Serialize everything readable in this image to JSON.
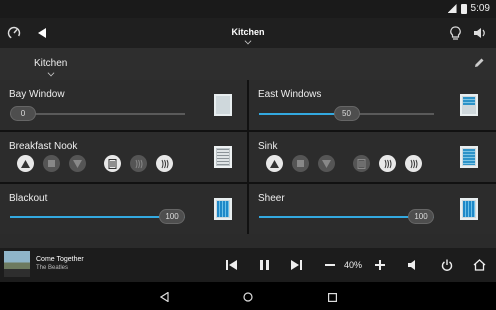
{
  "status_bar": {
    "time": "5:09"
  },
  "top_bar": {
    "title": "Kitchen",
    "icons": [
      "gauge-icon",
      "back-icon",
      "lightbulb-icon",
      "volume-icon"
    ]
  },
  "room_selector": {
    "label": "Kitchen",
    "edit_icon": "pencil-icon"
  },
  "shades": [
    {
      "name": "Bay Window",
      "level": 0,
      "value_label": "0",
      "icon": "window-icon"
    },
    {
      "name": "East Windows",
      "level": 50,
      "value_label": "50",
      "icon": "window-partial-icon"
    },
    {
      "name": "Breakfast Nook",
      "icon": "blinds-icon",
      "controls": [
        "up-icon",
        "stop-icon",
        "down-icon",
        "preset-1-icon",
        "preset-2-icon",
        "preset-3-icon"
      ]
    },
    {
      "name": "Sink",
      "icon": "shade-icon",
      "controls": [
        "up-icon",
        "stop-icon",
        "down-icon",
        "preset-1-icon",
        "preset-2-icon",
        "preset-3-icon"
      ]
    },
    {
      "name": "Blackout",
      "level": 100,
      "value_label": "100",
      "icon": "blackout-icon"
    },
    {
      "name": "Sheer",
      "level": 100,
      "value_label": "100",
      "icon": "sheer-icon"
    }
  ],
  "now_playing": {
    "song": "Come Together",
    "artist": "The Beatles",
    "volume_label": "40%",
    "controls": [
      "previous-icon",
      "pause-icon",
      "next-icon",
      "volume-down-icon",
      "volume-up-icon",
      "mute-icon",
      "power-icon",
      "home-icon"
    ]
  },
  "colors": {
    "accent": "#33a9e0",
    "background": "#2c2c2c",
    "bar": "#1f1f1f"
  }
}
